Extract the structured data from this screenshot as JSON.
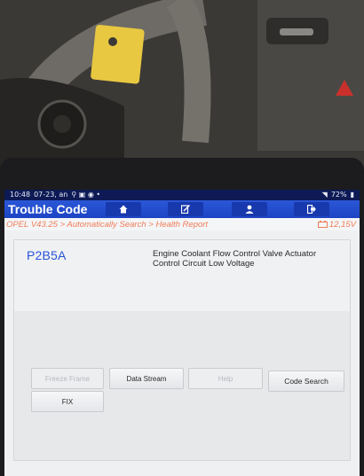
{
  "status_bar": {
    "time": "10:48",
    "date": "07-23, an",
    "battery": "72%"
  },
  "header": {
    "title": "Trouble Code"
  },
  "toolbar": {
    "icons": [
      "home-icon",
      "edit-report-icon",
      "user-icon",
      "exit-icon"
    ]
  },
  "breadcrumb": {
    "path": "OPEL V43.25 > Automatically Search > Health Report",
    "voltage": "12,15V"
  },
  "dtc": {
    "code": "P2B5A",
    "description": "Engine Coolant Flow Control Valve Actuator Control Circuit Low Voltage"
  },
  "actions": {
    "freeze_frame": "Freeze Frame",
    "data_stream": "Data Stream",
    "help": "Help",
    "code_search": "Code Search",
    "fix": "FIX"
  },
  "colors": {
    "title_bar": "#1d44c4",
    "status_bar": "#0d1a55",
    "breadcrumb_text": "#ef7d57",
    "dtc_code": "#2853d8"
  }
}
